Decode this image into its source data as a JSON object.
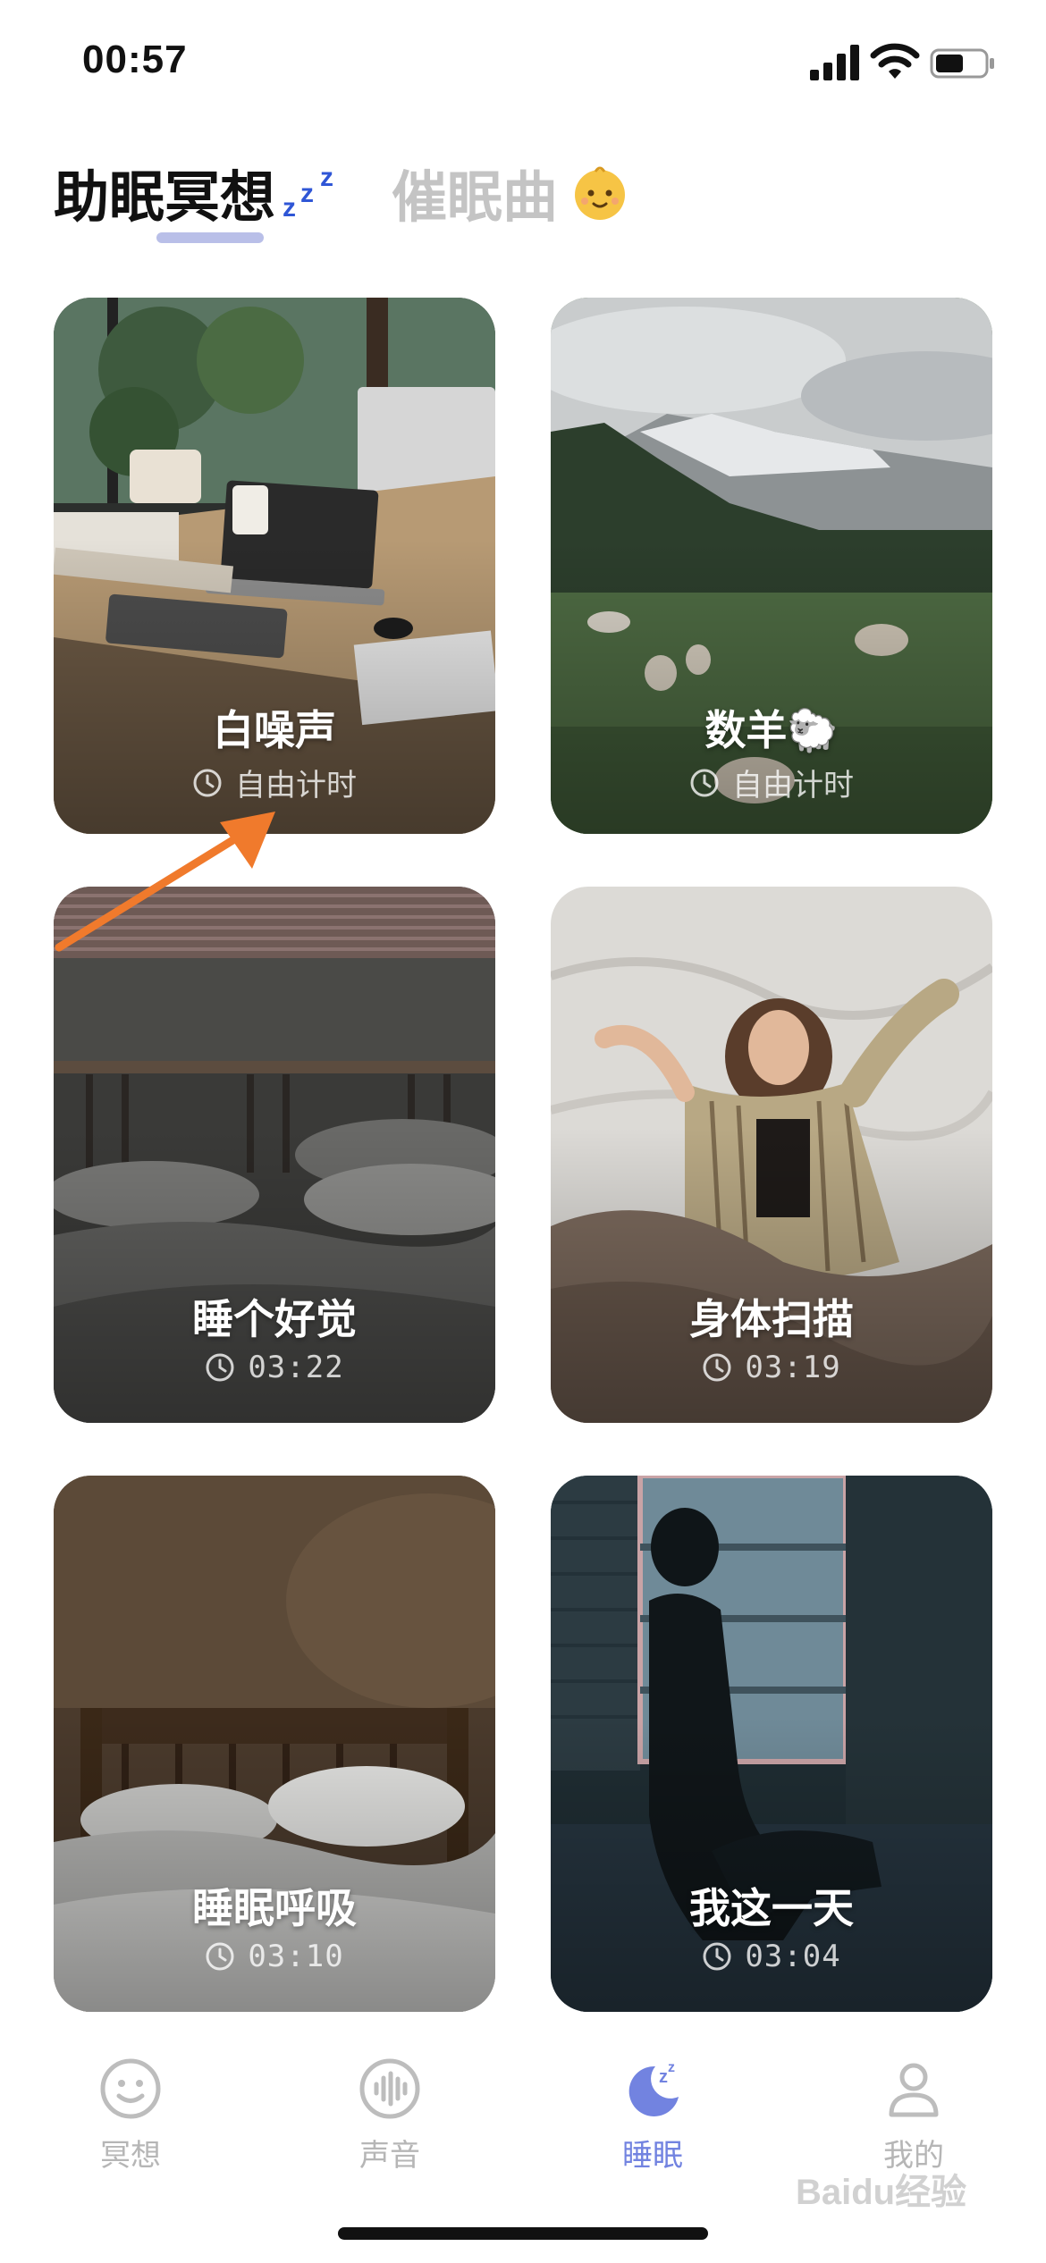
{
  "status_bar": {
    "time": "00:57"
  },
  "header": {
    "tabs": [
      {
        "label": "助眠冥想",
        "active": true,
        "icon": "zzz-icon"
      },
      {
        "label": "催眠曲",
        "active": false,
        "icon": "baby-face-icon"
      }
    ]
  },
  "cards": [
    {
      "title": "白噪声",
      "meta": "自由计时",
      "icon": "clock-icon",
      "scene": "desk-workspace"
    },
    {
      "title": "数羊🐑",
      "meta": "自由计时",
      "icon": "clock-icon",
      "scene": "mountain-sheep"
    },
    {
      "title": "睡个好觉",
      "meta": "03:22",
      "icon": "clock-icon",
      "scene": "dark-bedroom"
    },
    {
      "title": "身体扫描",
      "meta": "03:19",
      "icon": "clock-icon",
      "scene": "woman-sleeping"
    },
    {
      "title": "睡眠呼吸",
      "meta": "03:10",
      "icon": "clock-icon",
      "scene": "wooden-bed"
    },
    {
      "title": "我这一天",
      "meta": "03:04",
      "icon": "clock-icon",
      "scene": "woman-silhouette-window"
    }
  ],
  "bottom_nav": [
    {
      "label": "冥想",
      "icon": "smile-icon",
      "active": false
    },
    {
      "label": "声音",
      "icon": "soundwave-icon",
      "active": false
    },
    {
      "label": "睡眠",
      "icon": "moon-zz-icon",
      "active": true
    },
    {
      "label": "我的",
      "icon": "person-icon",
      "active": false
    }
  ],
  "watermark": "Baidu经验",
  "colors": {
    "accent": "#7283e0",
    "indicator": "#b9bfe8",
    "annotation_arrow": "#f07a2c"
  }
}
